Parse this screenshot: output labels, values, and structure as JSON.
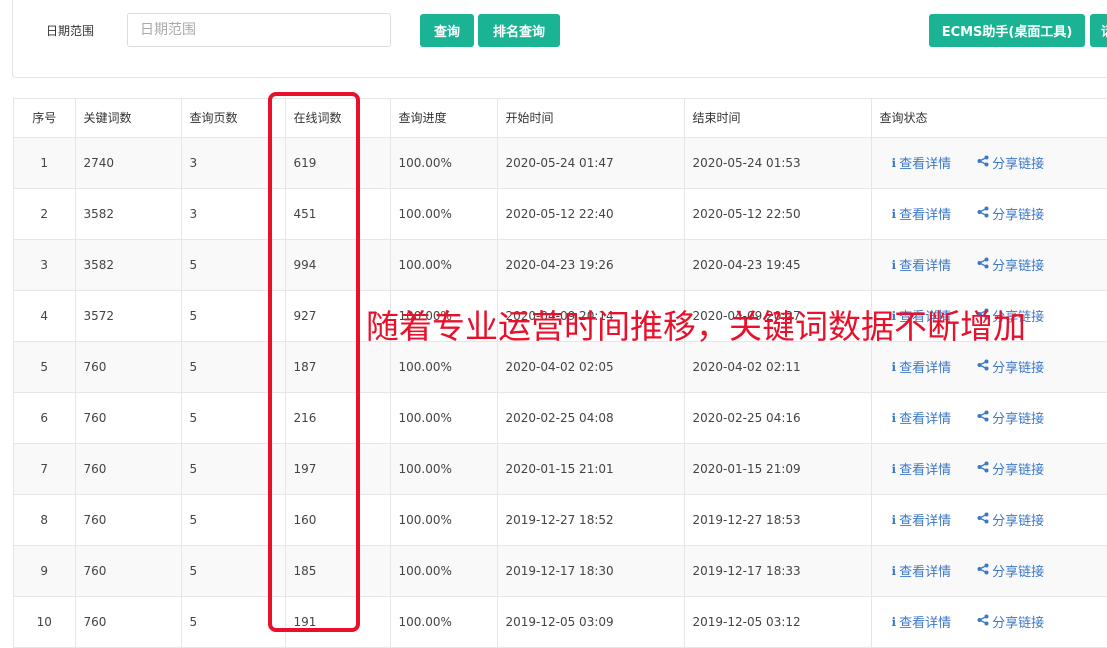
{
  "filter": {
    "label": "日期范围",
    "date_placeholder": "日期范围"
  },
  "buttons": {
    "query": "查询",
    "rank_query": "排名查询",
    "ecms_helper": "ECMS助手(桌面工具)",
    "cut_off": "话"
  },
  "table": {
    "headers": {
      "idx": "序号",
      "keywords": "关键词数",
      "pages": "查询页数",
      "online": "在线词数",
      "progress": "查询进度",
      "start": "开始时间",
      "end": "结束时间",
      "status": "查询状态"
    },
    "rows": [
      {
        "idx": "1",
        "keywords": "2740",
        "pages": "3",
        "online": "619",
        "progress": "100.00%",
        "start": "2020-05-24 01:47",
        "end": "2020-05-24 01:53"
      },
      {
        "idx": "2",
        "keywords": "3582",
        "pages": "3",
        "online": "451",
        "progress": "100.00%",
        "start": "2020-05-12 22:40",
        "end": "2020-05-12 22:50"
      },
      {
        "idx": "3",
        "keywords": "3582",
        "pages": "5",
        "online": "994",
        "progress": "100.00%",
        "start": "2020-04-23 19:26",
        "end": "2020-04-23 19:45"
      },
      {
        "idx": "4",
        "keywords": "3572",
        "pages": "5",
        "online": "927",
        "progress": "100.00%",
        "start": "2020-04-09 20:14",
        "end": "2020-04-09 20:27"
      },
      {
        "idx": "5",
        "keywords": "760",
        "pages": "5",
        "online": "187",
        "progress": "100.00%",
        "start": "2020-04-02 02:05",
        "end": "2020-04-02 02:11"
      },
      {
        "idx": "6",
        "keywords": "760",
        "pages": "5",
        "online": "216",
        "progress": "100.00%",
        "start": "2020-02-25 04:08",
        "end": "2020-02-25 04:16"
      },
      {
        "idx": "7",
        "keywords": "760",
        "pages": "5",
        "online": "197",
        "progress": "100.00%",
        "start": "2020-01-15 21:01",
        "end": "2020-01-15 21:09"
      },
      {
        "idx": "8",
        "keywords": "760",
        "pages": "5",
        "online": "160",
        "progress": "100.00%",
        "start": "2019-12-27 18:52",
        "end": "2019-12-27 18:53"
      },
      {
        "idx": "9",
        "keywords": "760",
        "pages": "5",
        "online": "185",
        "progress": "100.00%",
        "start": "2019-12-17 18:30",
        "end": "2019-12-17 18:33"
      },
      {
        "idx": "10",
        "keywords": "760",
        "pages": "5",
        "online": "191",
        "progress": "100.00%",
        "start": "2019-12-05 03:09",
        "end": "2019-12-05 03:12"
      }
    ],
    "detail_label": "查看详情",
    "share_label": "分享链接",
    "detail_icon": "info-icon",
    "share_icon": "share-icon"
  },
  "annotation": {
    "text": "随着专业运营时间推移，关键词数据不断增加",
    "color": "#e8102a"
  },
  "colors": {
    "accent": "#1ab394",
    "link": "#3c78c8"
  }
}
